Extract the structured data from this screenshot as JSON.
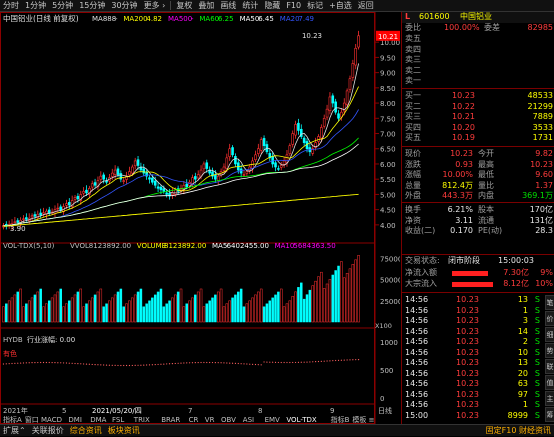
{
  "toolbar": {
    "items": [
      "分时",
      "1分钟",
      "5分钟",
      "15分钟",
      "30分钟",
      "更多 ›",
      "复权",
      "叠加",
      "画线",
      "统计",
      "隐藏",
      "F10",
      "标记",
      "+自选",
      "返回"
    ]
  },
  "chart_data": [
    {
      "type": "candlestick",
      "title": "中国铝业(日线 前复权)",
      "indicators": [
        {
          "name": "MA888",
          "value": "-"
        },
        {
          "name": "MA200",
          "value": "4.82"
        },
        {
          "name": "MA500",
          "value": "-"
        },
        {
          "name": "MA60",
          "value": "6.25"
        },
        {
          "name": "MA50",
          "value": "6.45"
        },
        {
          "name": "MA20",
          "value": "7.49"
        }
      ],
      "y_ticks": [
        "10.00",
        "9.50",
        "9.00",
        "8.50",
        "8.00",
        "7.50",
        "7.00",
        "6.50",
        "6.00",
        "5.50",
        "5.00",
        "4.50",
        "4.00"
      ],
      "ylim": [
        3.7,
        10.4
      ],
      "high_label": "10.23",
      "low_label": "3.90",
      "last_price_label": "10.21",
      "closes": [
        3.98,
        3.95,
        4.02,
        4.05,
        4.1,
        4.08,
        4.15,
        4.2,
        4.18,
        4.22,
        4.3,
        4.28,
        4.35,
        4.32,
        4.4,
        4.45,
        4.38,
        4.42,
        4.5,
        4.55,
        4.48,
        4.6,
        4.7,
        4.65,
        4.8,
        4.9,
        4.85,
        5.0,
        5.1,
        5.05,
        5.2,
        5.35,
        5.3,
        5.45,
        5.6,
        5.5,
        5.4,
        5.55,
        5.7,
        5.8,
        5.65,
        5.5,
        5.45,
        5.6,
        5.75,
        5.9,
        6.1,
        5.95,
        5.8,
        5.7,
        5.6,
        5.5,
        5.4,
        5.3,
        5.2,
        5.15,
        5.1,
        5.0,
        4.95,
        5.05,
        5.15,
        5.1,
        5.2,
        5.3,
        5.25,
        5.4,
        5.55,
        5.5,
        5.65,
        5.8,
        6.0,
        5.85,
        5.7,
        5.6,
        5.5,
        5.6,
        5.75,
        5.9,
        6.2,
        6.5,
        6.3,
        6.0,
        5.8,
        5.7,
        5.65,
        5.75,
        5.9,
        6.1,
        6.3,
        6.5,
        6.8,
        6.6,
        6.4,
        6.2,
        6.0,
        5.9,
        5.85,
        5.95,
        6.1,
        6.3,
        6.6,
        7.0,
        7.3,
        7.1,
        6.9,
        6.7,
        6.5,
        6.4,
        6.5,
        6.7,
        6.9,
        7.2,
        7.5,
        7.8,
        8.2,
        8.0,
        7.7,
        7.5,
        7.7,
        8.0,
        8.4,
        8.8,
        9.3,
        9.8,
        10.21
      ]
    },
    {
      "type": "bar",
      "title": "VOL-TDX(5,10)",
      "series_labels": [
        {
          "name": "VVOL",
          "value": "8123892.00"
        },
        {
          "name": "VOLUME",
          "value": "8123892.00"
        },
        {
          "name": "MA5",
          "value": "6402455.00"
        },
        {
          "name": "MA10",
          "value": "5684363.50"
        }
      ],
      "y_ticks": [
        "75000",
        "50000",
        "25000"
      ],
      "unit": "X100"
    },
    {
      "type": "line",
      "title": "HYDB",
      "sub_label": "行业涨幅: 0.00",
      "industry": "有色",
      "y_ticks": [
        "1000",
        "500",
        "0"
      ]
    }
  ],
  "x_axis_labels": [
    "2021年",
    "5",
    "2021/05/20/四",
    "7",
    "8",
    "9"
  ],
  "bottom_right_label": "日线",
  "tabs": [
    "指标A",
    "窗口",
    "MACD",
    "DMI",
    "DMA",
    "FSL",
    "TRIX",
    "BRAR",
    "CR",
    "VR",
    "OBV",
    "ASI",
    "EMV",
    "VOL-TDX",
    "指标B",
    "模板",
    "≡"
  ],
  "quote": {
    "code": "601600",
    "name": "中国铝业",
    "weibi_label": "委比",
    "weibi_value": "100.00%",
    "weicha_label": "委差",
    "weicha_value": "82985",
    "sells": [
      {
        "label": "卖五",
        "price": "",
        "vol": ""
      },
      {
        "label": "卖四",
        "price": "",
        "vol": ""
      },
      {
        "label": "卖三",
        "price": "",
        "vol": ""
      },
      {
        "label": "卖二",
        "price": "",
        "vol": ""
      },
      {
        "label": "卖一",
        "price": "",
        "vol": ""
      }
    ],
    "buys": [
      {
        "label": "买一",
        "price": "10.23",
        "vol": "48533"
      },
      {
        "label": "买二",
        "price": "10.22",
        "vol": "21299"
      },
      {
        "label": "买三",
        "price": "10.21",
        "vol": "7889"
      },
      {
        "label": "买四",
        "price": "10.20",
        "vol": "3533"
      },
      {
        "label": "买五",
        "price": "10.19",
        "vol": "1731"
      }
    ],
    "stats": [
      {
        "l1": "现价",
        "v1": "10.23",
        "c1": "red",
        "l2": "今开",
        "v2": "9.82",
        "c2": "red"
      },
      {
        "l1": "涨跌",
        "v1": "0.93",
        "c1": "red",
        "l2": "最高",
        "v2": "10.23",
        "c2": "red"
      },
      {
        "l1": "涨幅",
        "v1": "10.00%",
        "c1": "red",
        "l2": "最低",
        "v2": "9.60",
        "c2": "red"
      },
      {
        "l1": "总量",
        "v1": "812.4万",
        "c1": "yel",
        "l2": "量比",
        "v2": "1.37",
        "c2": "red"
      },
      {
        "l1": "外盘",
        "v1": "443.3万",
        "c1": "red",
        "l2": "内盘",
        "v2": "369.1万",
        "c2": "grn"
      },
      {
        "l1": "换手",
        "v1": "6.21%",
        "c1": "wht",
        "l2": "股本",
        "v2": "170亿",
        "c2": "wht"
      },
      {
        "l1": "净资",
        "v1": "3.11",
        "c1": "wht",
        "l2": "流通",
        "v2": "131亿",
        "c2": "wht"
      },
      {
        "l1": "收益(二)",
        "v1": "0.170",
        "c1": "wht",
        "l2": "PE(动)",
        "v2": "28.3",
        "c2": "wht"
      }
    ],
    "trade_status_label": "交易状态:",
    "trade_status_value": "闭市阶段",
    "trade_status_time": "15:00:03",
    "netflow": [
      {
        "label": "净流入额",
        "value": "7.30亿",
        "pct": "9%",
        "bar": 0.6
      },
      {
        "label": "大宗流入",
        "value": "8.12亿",
        "pct": "10%",
        "bar": 0.68
      }
    ],
    "ticks": [
      {
        "time": "14:56",
        "price": "10.23",
        "vol": "13",
        "dir": "S"
      },
      {
        "time": "14:56",
        "price": "10.23",
        "vol": "1",
        "dir": "S"
      },
      {
        "time": "14:56",
        "price": "10.23",
        "vol": "3",
        "dir": "S"
      },
      {
        "time": "14:56",
        "price": "10.23",
        "vol": "14",
        "dir": "S"
      },
      {
        "time": "14:56",
        "price": "10.23",
        "vol": "2",
        "dir": "S"
      },
      {
        "time": "14:56",
        "price": "10.23",
        "vol": "10",
        "dir": "S"
      },
      {
        "time": "14:56",
        "price": "10.23",
        "vol": "13",
        "dir": "S"
      },
      {
        "time": "14:56",
        "price": "10.23",
        "vol": "20",
        "dir": "S"
      },
      {
        "time": "14:56",
        "price": "10.23",
        "vol": "63",
        "dir": "S"
      },
      {
        "time": "14:56",
        "price": "10.23",
        "vol": "97",
        "dir": "S"
      },
      {
        "time": "14:56",
        "price": "10.23",
        "vol": "1",
        "dir": "S"
      },
      {
        "time": "15:00",
        "price": "10.23",
        "vol": "8999",
        "dir": "S"
      }
    ],
    "side_tabs": [
      "笔",
      "价",
      "细",
      "势",
      "联",
      "值",
      "主",
      "筹"
    ]
  },
  "statusbar": {
    "items": [
      "扩展⌃",
      "关联报价",
      "综合资讯",
      "板块资讯"
    ],
    "right": "固定F10 财经资讯"
  }
}
